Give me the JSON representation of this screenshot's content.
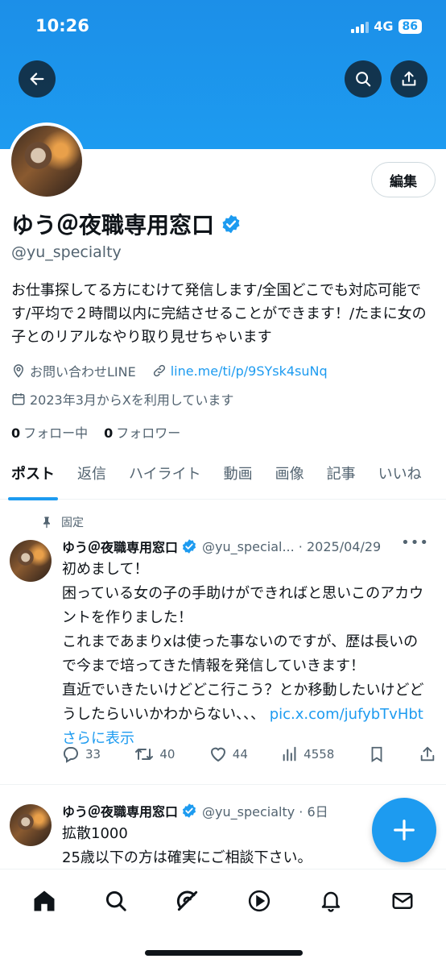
{
  "status_bar": {
    "time": "10:26",
    "network": "4G",
    "battery": "86"
  },
  "profile": {
    "display_name": "ゆう＠夜職専用窓口",
    "handle": "@yu_specialty",
    "edit_label": "編集",
    "bio": "お仕事探してる方にむけて発信します/全国どこでも対応可能です/平均で２時間以内に完結させることができます！/たまに女の子とのリアルなやり取り見せちゃいます",
    "location": "お問い合わせLINE",
    "link": "line.me/ti/p/9SYsk4suNq",
    "joined": "2023年3月からXを利用しています",
    "following_count": "0",
    "following_label": "フォロー中",
    "followers_count": "0",
    "followers_label": "フォロワー"
  },
  "tabs": [
    "ポスト",
    "返信",
    "ハイライト",
    "動画",
    "画像",
    "記事",
    "いいね"
  ],
  "pinned_label": "固定",
  "tweets": [
    {
      "name": "ゆう＠夜職専用窓口",
      "handle": "@yu_special... · 2025/04/29",
      "text_lines": [
        "初めまして！",
        "困っている女の子の手助けができればと思いこのアカウントを作りました！",
        "これまであまりxは使った事ないのですが、歴は長いので今まで培ってきた情報を発信していきます！",
        "直近でいきたいけどどこ行こう？とか移動したいけどどうしたらいいかわからない、、、"
      ],
      "link_text": "pic.x.com/jufybTvHbt",
      "show_more": "さらに表示",
      "replies": "33",
      "reposts": "40",
      "likes": "44",
      "views": "4558"
    },
    {
      "name": "ゆう＠夜職専用窓口",
      "handle": "@yu_specialty · 6日",
      "text_lines": [
        "拡散1000",
        "25歳以下の方は確実にご相談下さい。"
      ]
    }
  ],
  "colors": {
    "accent": "#1d9bf0",
    "text": "#0f1419",
    "muted": "#536471"
  },
  "icons": [
    "back-arrow-icon",
    "search-icon",
    "share-icon",
    "verified-badge-icon",
    "location-icon",
    "link-icon",
    "calendar-icon",
    "pin-icon",
    "reply-icon",
    "repost-icon",
    "like-icon",
    "views-icon",
    "bookmark-icon",
    "compose-icon",
    "home-icon",
    "explore-icon",
    "grok-icon",
    "video-icon",
    "notifications-icon",
    "messages-icon"
  ]
}
